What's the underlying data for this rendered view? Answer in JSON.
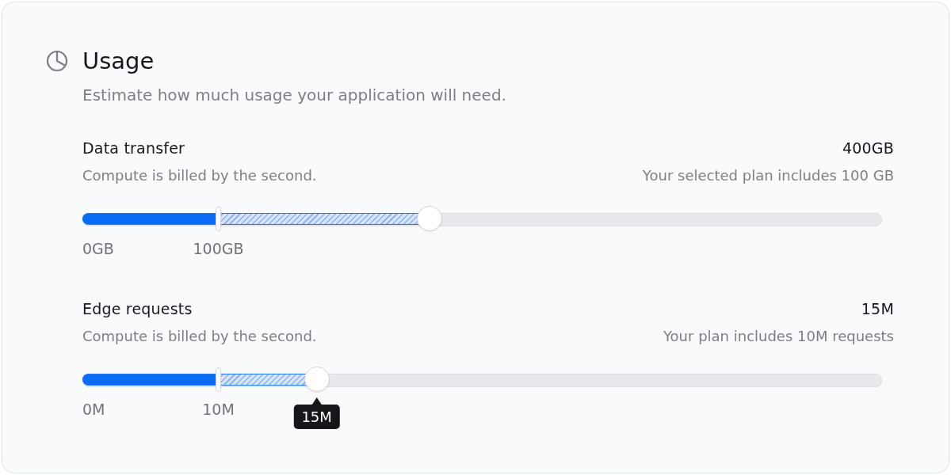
{
  "card": {
    "title": "Usage",
    "subtitle": "Estimate how much usage your application will need."
  },
  "sliders": [
    {
      "name": "Data transfer",
      "value": "400GB",
      "description": "Compute is billed by the second.",
      "note": "Your selected plan includes 100 GB",
      "level": 0.434,
      "start_label": "0GB",
      "included": {
        "level": 0.17,
        "label": "100GB"
      }
    },
    {
      "name": "Edge requests",
      "value": "15M",
      "description": "Compute is billed by the second.",
      "note": "Your plan includes 10M requests",
      "level": 0.293,
      "start_label": "0M",
      "included": {
        "level": 0.17,
        "label": "10M"
      },
      "tooltip": "15M"
    }
  ]
}
